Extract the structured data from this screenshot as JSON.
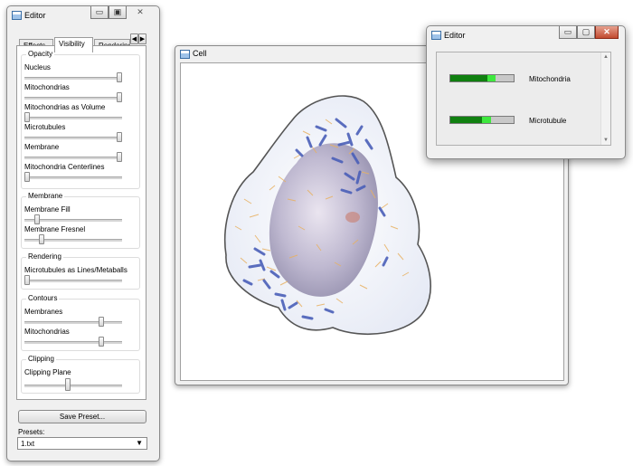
{
  "editor": {
    "title": "Editor",
    "tabs": [
      "Effects",
      "Visibility",
      "Rendering"
    ],
    "groups": {
      "opacity": {
        "title": "Opacity",
        "sliders": [
          {
            "label": "Nucleus",
            "value": 1.0
          },
          {
            "label": "Mitochondrias",
            "value": 1.0
          },
          {
            "label": "Mitochondrias as Volume",
            "value": 0.0
          },
          {
            "label": "Microtubules",
            "value": 1.0
          },
          {
            "label": "Membrane",
            "value": 1.0
          },
          {
            "label": "Mitochondria Centerlines",
            "value": 0.0
          }
        ]
      },
      "membrane": {
        "title": "Membrane",
        "sliders": [
          {
            "label": "Membrane Fill",
            "value": 0.1
          },
          {
            "label": "Membrane Fresnel",
            "value": 0.15
          }
        ]
      },
      "rendering": {
        "title": "Rendering",
        "sliders": [
          {
            "label": "Microtubules as Lines/Metaballs",
            "value": 0.0
          }
        ]
      },
      "contours": {
        "title": "Contours",
        "sliders": [
          {
            "label": "Membranes",
            "value": 0.8
          },
          {
            "label": "Mitochondrias",
            "value": 0.8
          }
        ]
      },
      "clipping": {
        "title": "Clipping",
        "sliders": [
          {
            "label": "Clipping Plane",
            "value": 0.45
          }
        ]
      }
    },
    "save_preset_label": "Save Preset...",
    "presets_label": "Presets:",
    "presets_value": "1.txt"
  },
  "cell_window": {
    "title": "Cell"
  },
  "editor2": {
    "title": "Editor",
    "bars": [
      {
        "label": "Mitochondria",
        "fill": 0.58,
        "highlight": 0.14
      },
      {
        "label": "Microtubule",
        "fill": 0.5,
        "highlight": 0.14
      }
    ]
  },
  "colors": {
    "bar_green": "#108010",
    "bar_highlight": "#3ee83e",
    "bar_empty": "#c8c8c8",
    "window_bg": "#f0f0f0",
    "mito_blue": "#4a5fb8",
    "microtubule_orange": "#e8b060",
    "nucleus": "#b9b2cc"
  },
  "icons": [
    "app-icon",
    "minimize-icon",
    "maximize-icon",
    "close-icon",
    "tab-scroll-left-icon",
    "tab-scroll-right-icon",
    "dropdown-arrow-icon"
  ]
}
